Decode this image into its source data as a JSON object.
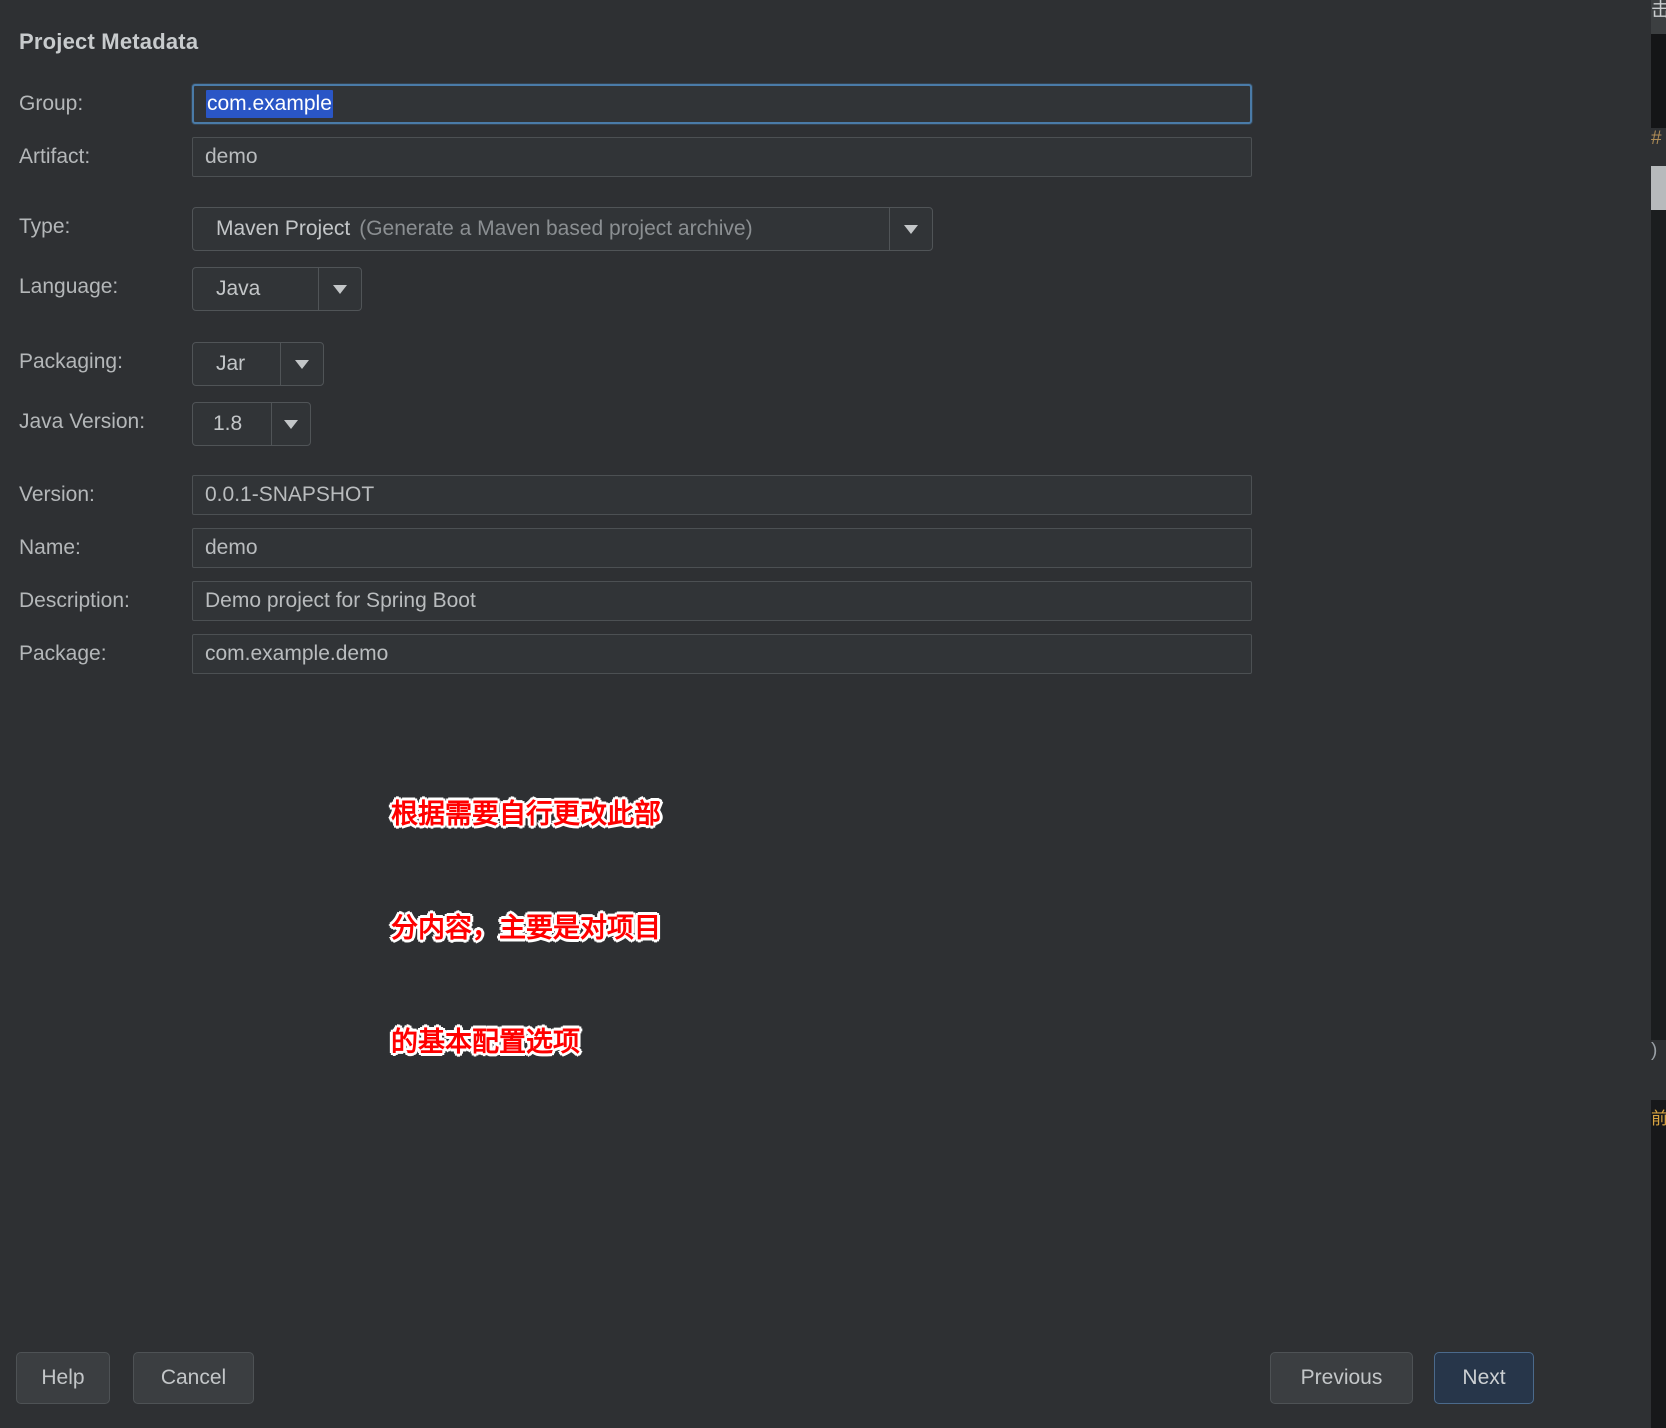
{
  "dialog": {
    "section_title": "Project Metadata"
  },
  "form": {
    "rows": [
      {
        "label": "Group:",
        "value": "com.example",
        "kind": "text",
        "focused": true
      },
      {
        "label": "Artifact:",
        "value": "demo",
        "kind": "text",
        "focused": false
      },
      {
        "label": "Type:",
        "value": "Maven Project",
        "hint": "(Generate a Maven based project archive)",
        "kind": "combo"
      },
      {
        "label": "Language:",
        "value": "Java",
        "kind": "combo"
      },
      {
        "label": "Packaging:",
        "value": "Jar",
        "kind": "combo"
      },
      {
        "label": "Java Version:",
        "value": "1.8",
        "kind": "combo"
      },
      {
        "label": "Version:",
        "value": "0.0.1-SNAPSHOT",
        "kind": "text",
        "focused": false
      },
      {
        "label": "Name:",
        "value": "demo",
        "kind": "text",
        "focused": false
      },
      {
        "label": "Description:",
        "value": "Demo project for Spring Boot",
        "kind": "text",
        "focused": false
      },
      {
        "label": "Package:",
        "value": "com.example.demo",
        "kind": "text",
        "focused": false
      }
    ]
  },
  "annotation": {
    "line1": "根据需要自行更改此部",
    "line2": "分内容，主要是对项目",
    "line3": "的基本配置选项",
    "color": "#ff0000"
  },
  "buttons": {
    "help": "Help",
    "cancel": "Cancel",
    "previous": "Previous",
    "next": "Next",
    "next_accent": "#27364a"
  },
  "edge": {
    "chip_a": "击",
    "chip_c": "#",
    "chip_f": ")",
    "chip_h": "前\n组"
  },
  "icons": {
    "dropdown": "chevron-down-icon"
  }
}
